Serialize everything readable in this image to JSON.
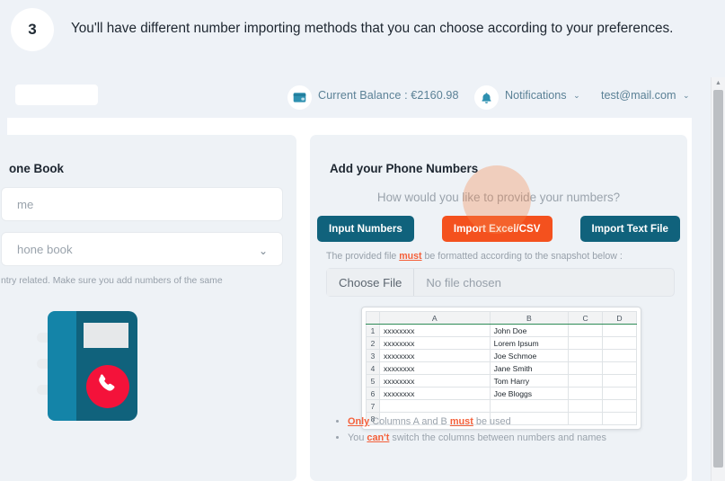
{
  "callout": {
    "step_number": "3",
    "text": "You'll have different number importing methods that you can choose according to your preferences."
  },
  "topbar": {
    "wallet_icon": "wallet-icon",
    "balance_label": "Current Balance :  €2160.98",
    "bell_icon": "bell-icon",
    "notifications_label": "Notifications",
    "account_label": "test@mail.com",
    "caret": "⌄"
  },
  "left_card": {
    "title": "one Book",
    "name_field_placeholder": "me",
    "select_field_value": "hone book",
    "select_caret": "⌄",
    "help_text": "ntry related. Make sure you add numbers of the same",
    "illustration": "phone-book-illustration"
  },
  "right_card": {
    "title": "Add your Phone Numbers",
    "prompt": "How would you like to provide your numbers?",
    "buttons": [
      {
        "label": "Input Numbers",
        "state": "inactive"
      },
      {
        "label": "Import Excel/CSV",
        "state": "active"
      },
      {
        "label": "Import Text File",
        "state": "inactive"
      }
    ],
    "format_note_prefix": "The provided file ",
    "format_note_emph": "must",
    "format_note_suffix": " be formatted according to the snapshot below :",
    "file_input": {
      "button_label": "Choose File",
      "status": "No file chosen"
    },
    "rules": [
      {
        "emph": "Only",
        "prefix": "",
        "suffix": " Columns A and B ",
        "emph2": "must",
        "suffix2": " be used"
      },
      {
        "emph": "",
        "prefix": "You ",
        "suffix": "",
        "emph2": "can't",
        "suffix2": " switch the columns between numbers and names"
      }
    ]
  },
  "snapshot": {
    "type": "table",
    "columns": [
      "",
      "A",
      "B",
      "C",
      "D"
    ],
    "rows": [
      {
        "n": "1",
        "a": "xxxxxxxx",
        "b": "John Doe",
        "c": "",
        "d": ""
      },
      {
        "n": "2",
        "a": "xxxxxxxx",
        "b": "Lorem Ipsum",
        "c": "",
        "d": ""
      },
      {
        "n": "3",
        "a": "xxxxxxxx",
        "b": "Joe Schmoe",
        "c": "",
        "d": ""
      },
      {
        "n": "4",
        "a": "xxxxxxxx",
        "b": "Jane Smith",
        "c": "",
        "d": ""
      },
      {
        "n": "5",
        "a": "xxxxxxxx",
        "b": "Tom Harry",
        "c": "",
        "d": ""
      },
      {
        "n": "6",
        "a": "xxxxxxxx",
        "b": "Joe Bloggs",
        "c": "",
        "d": ""
      },
      {
        "n": "7",
        "a": "",
        "b": "",
        "c": "",
        "d": ""
      },
      {
        "n": "8",
        "a": "",
        "b": "",
        "c": "",
        "d": ""
      }
    ]
  },
  "scrollbar": {
    "up_arrow": "▲"
  },
  "colors": {
    "page_background": "#eef2f7",
    "card_background": "#eef2f6",
    "teal_button": "#10627c",
    "active_button": "#f4511e",
    "accent_orange": "#f4603a",
    "muted_text": "#9aa3ac",
    "topbar_text": "#5b8196",
    "illustration_book": "#10627c",
    "illustration_spine": "#1484a8",
    "illustration_badge": "#f4123a"
  }
}
